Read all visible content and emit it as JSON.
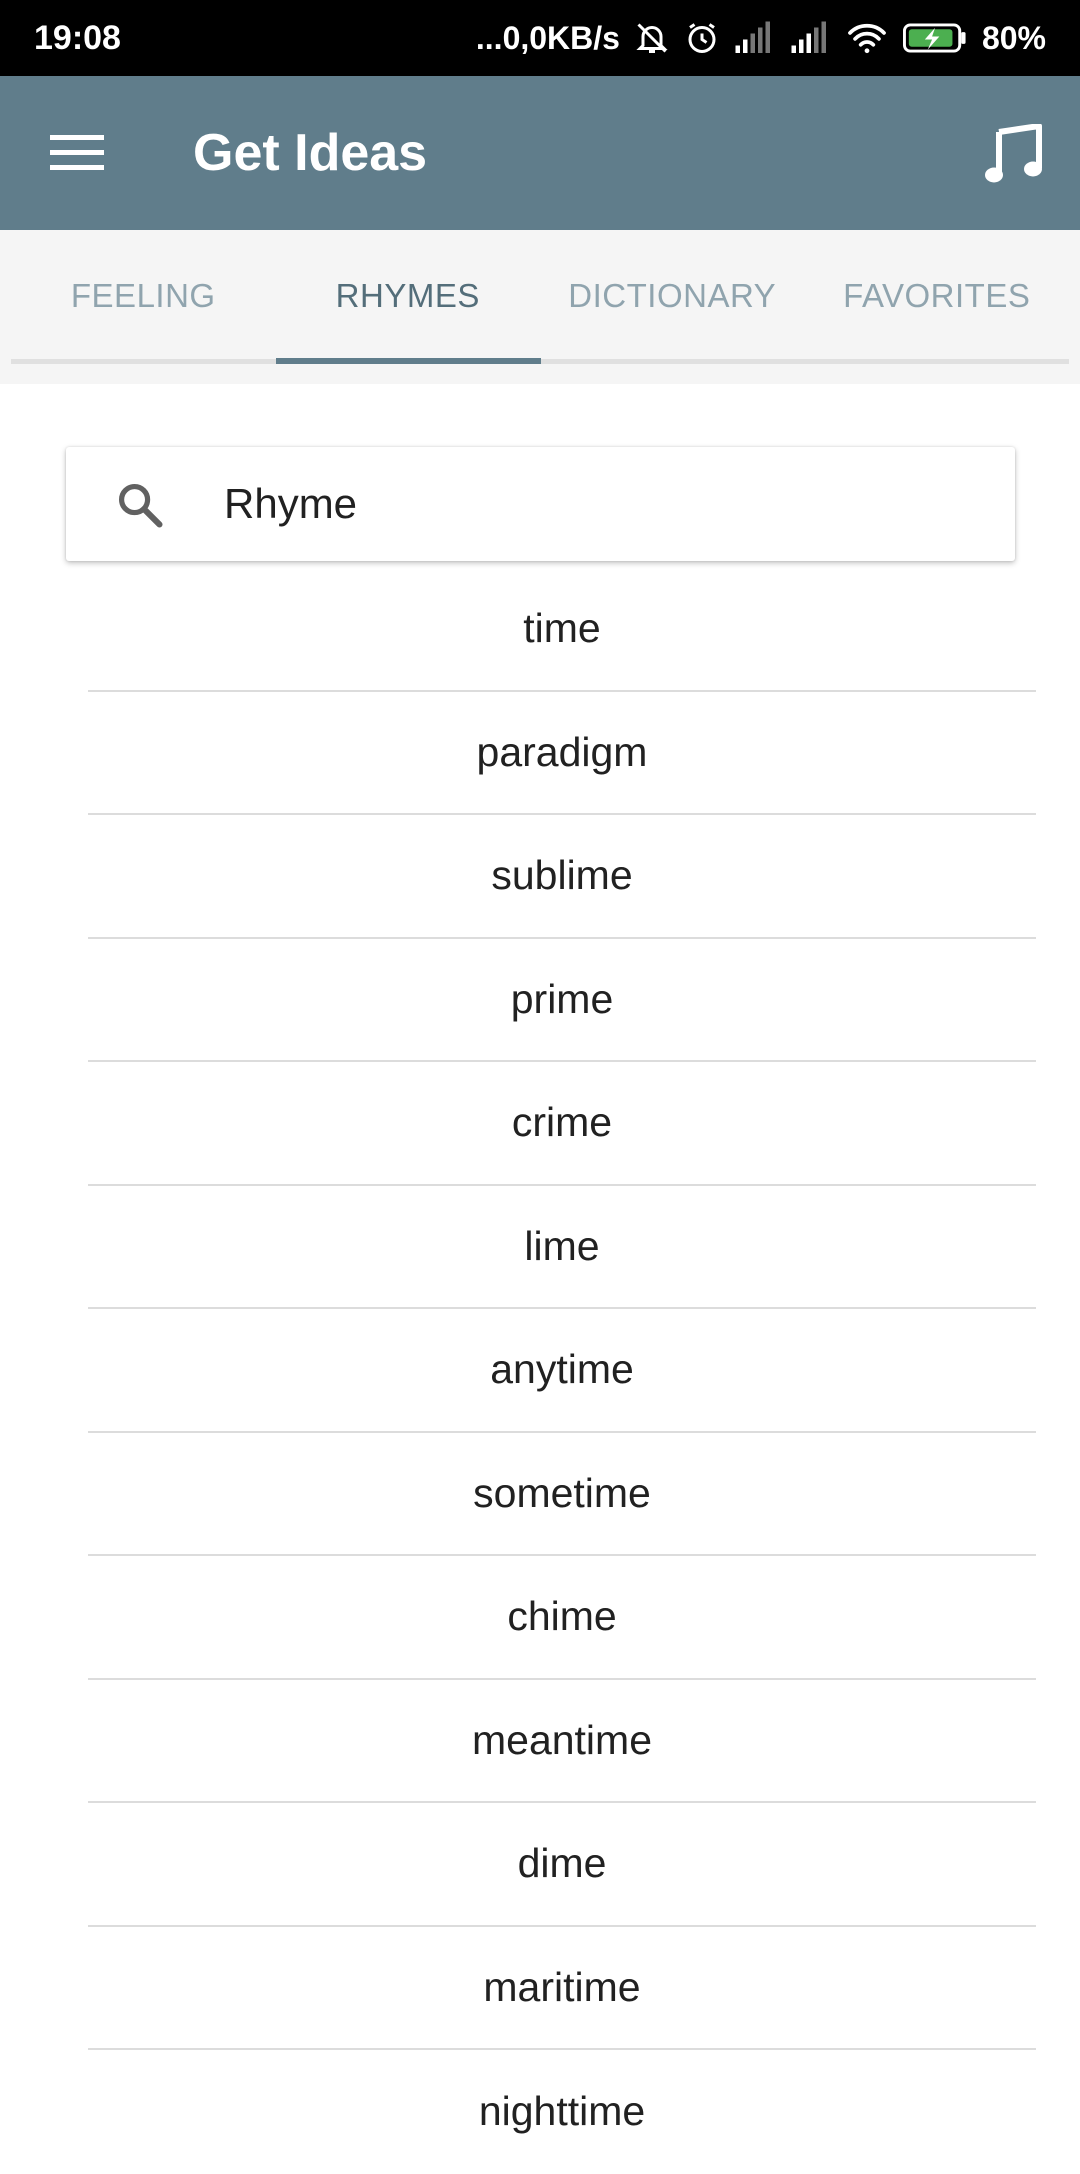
{
  "status_bar": {
    "time": "19:08",
    "network_speed": "...0,0KB/s",
    "battery": "80%"
  },
  "app_bar": {
    "title": "Get Ideas",
    "menu_icon": "hamburger-menu-icon",
    "action_icon": "music-note-icon"
  },
  "tabs": [
    {
      "label": "FEELING",
      "active": false
    },
    {
      "label": "RHYMES",
      "active": true
    },
    {
      "label": "DICTIONARY",
      "active": false
    },
    {
      "label": "FAVORITES",
      "active": false
    }
  ],
  "search": {
    "placeholder": "Rhyme",
    "value": ""
  },
  "rhymes": [
    "time",
    "paradigm",
    "sublime",
    "prime",
    "crime",
    "lime",
    "anytime",
    "sometime",
    "chime",
    "meantime",
    "dime",
    "maritime",
    "nighttime"
  ],
  "colors": {
    "app_bar": "#607d8b",
    "tab_active": "#546e7a",
    "tab_inactive": "#90a4ae",
    "status_bar": "#000000",
    "battery_fill": "#4caf50"
  }
}
